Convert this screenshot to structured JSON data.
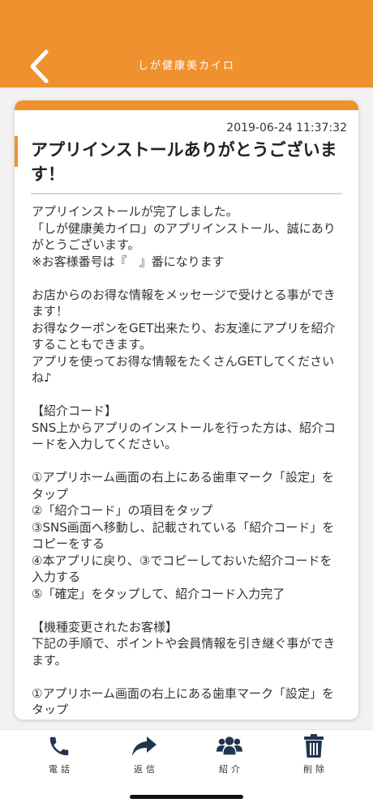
{
  "header": {
    "title": "しが健康美カイロ"
  },
  "message": {
    "timestamp": "2019-06-24 11:37:32",
    "title": "アプリインストールありがとうございます！",
    "body_lines": [
      "アプリインストールが完了しました。",
      "「しが健康美カイロ」のアプリインストール、誠にありがとうございます。",
      "※お客様番号は『　』番になります",
      "",
      "お店からのお得な情報をメッセージで受けとる事ができます！",
      "お得なクーポンをGET出来たり、お友達にアプリを紹介することもできます。",
      "アプリを使ってお得な情報をたくさんGETしてくださいね♪",
      "",
      "【紹介コード】",
      "SNS上からアプリのインストールを行った方は、紹介コードを入力してください。",
      "",
      "①アプリホーム画面の右上にある歯車マーク「設定」をタップ",
      "②「紹介コード」の項目をタップ",
      "③SNS画面へ移動し、記載されている「紹介コード」をコピーをする",
      "④本アプリに戻り、③でコピーしておいた紹介コードを入力する",
      "⑤「確定」をタップして、紹介コード入力完了",
      "",
      "【機種変更されたお客様】",
      "下記の手順で、ポイントや会員情報を引き継ぐ事ができます。",
      "",
      "①アプリホーム画面の右上にある歯車マーク「設定」をタップ"
    ]
  },
  "toolbar": {
    "phone": {
      "label": "電話",
      "icon": "phone-icon"
    },
    "reply": {
      "label": "返信",
      "icon": "reply-arrow-icon"
    },
    "introduce": {
      "label": "紹介",
      "icon": "users-icon"
    },
    "delete": {
      "label": "削除",
      "icon": "trash-icon"
    }
  },
  "colors": {
    "accent": "#f0912f",
    "text": "#333333",
    "background": "#f2f2f2"
  }
}
